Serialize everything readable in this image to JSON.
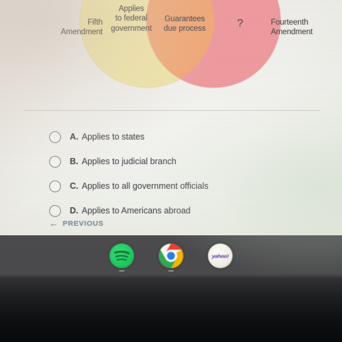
{
  "page": {
    "background_color": "#f1f0ec",
    "taskbar_color": "#4a4a4c"
  },
  "venn": {
    "left_circle": {
      "outer_label": "Fifth\nAmendment",
      "outer_label_line1": "Fifth",
      "outer_label_line2": "Amendment",
      "inner_label_line1": "Applies",
      "inner_label_line2": "to federal",
      "inner_label_line3": "government",
      "color": "#efe4a8"
    },
    "right_circle": {
      "outer_label_line1": "Fourteenth",
      "outer_label_line2": "Amendment",
      "inner_label": "?",
      "color": "#ee9a9e"
    },
    "overlap": {
      "label_line1": "Guarantees",
      "label_line2": "due process",
      "color": "#f0a878"
    }
  },
  "question": {
    "options": [
      {
        "letter": "A.",
        "text": "Applies to states",
        "selected": false
      },
      {
        "letter": "B.",
        "text": "Applies to judicial branch",
        "selected": false
      },
      {
        "letter": "C.",
        "text": "Applies to all government officials",
        "selected": false
      },
      {
        "letter": "D.",
        "text": "Applies to Americans abroad",
        "selected": false
      }
    ]
  },
  "navigation": {
    "previous_arrow": "←",
    "previous_label": "PREVIOUS"
  },
  "taskbar": {
    "items": [
      {
        "name": "spotify",
        "icon": "spotify-icon",
        "running": true
      },
      {
        "name": "chrome",
        "icon": "chrome-icon",
        "running": true
      },
      {
        "name": "yahoo",
        "icon": "yahoo-icon",
        "label": "yahoo!",
        "running": false
      }
    ]
  }
}
